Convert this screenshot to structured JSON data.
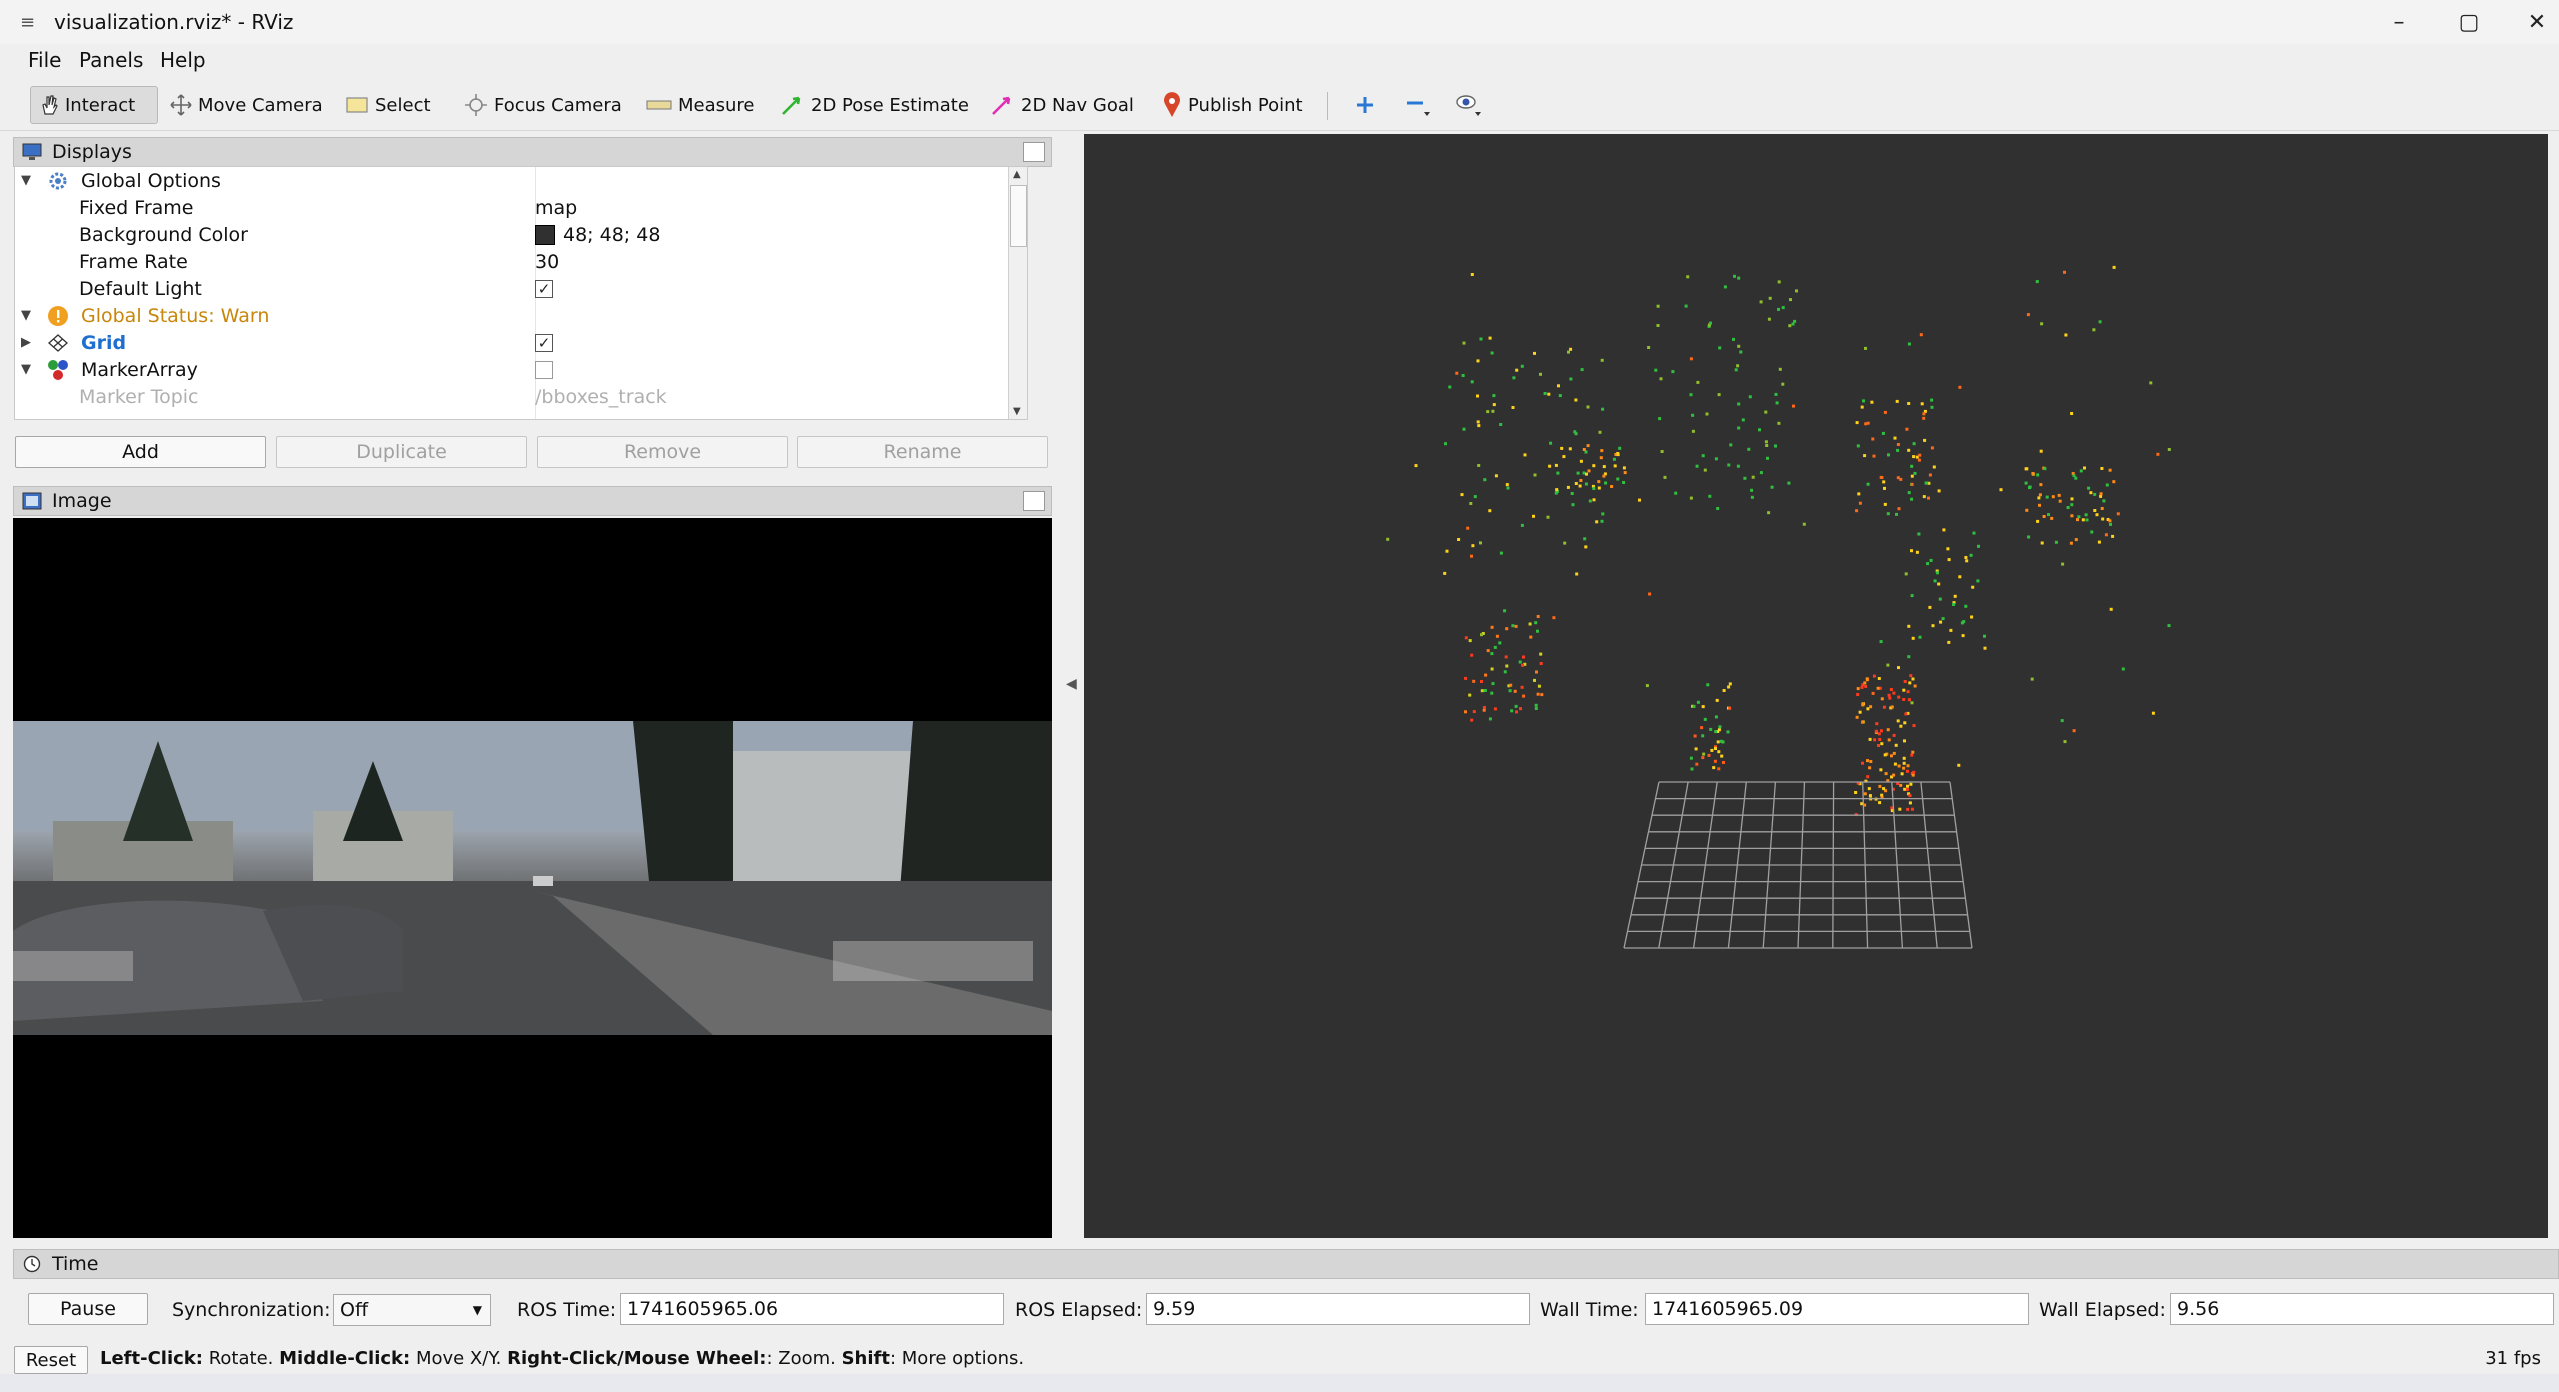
{
  "window": {
    "title": "visualization.rviz* - RViz"
  },
  "menu": [
    {
      "label": "File"
    },
    {
      "label": "Panels"
    },
    {
      "label": "Help"
    }
  ],
  "toolbar": {
    "tools": [
      {
        "label": "Interact",
        "icon": "hand-icon",
        "active": true
      },
      {
        "label": "Move Camera",
        "icon": "move-camera-icon"
      },
      {
        "label": "Select",
        "icon": "select-box-icon"
      },
      {
        "label": "Focus Camera",
        "icon": "focus-camera-icon"
      },
      {
        "label": "Measure",
        "icon": "ruler-icon"
      },
      {
        "label": "2D Pose Estimate",
        "icon": "green-arrow-icon"
      },
      {
        "label": "2D Nav Goal",
        "icon": "pink-arrow-icon"
      },
      {
        "label": "Publish Point",
        "icon": "map-pin-icon"
      }
    ]
  },
  "displays": {
    "title": "Displays",
    "rows": [
      {
        "label": "Global Options",
        "value": ""
      },
      {
        "label": "Fixed Frame",
        "value": "map"
      },
      {
        "label": "Background Color",
        "value": "48; 48; 48"
      },
      {
        "label": "Frame Rate",
        "value": "30"
      },
      {
        "label": "Default Light",
        "value": ""
      },
      {
        "label": "Global Status: Warn",
        "value": ""
      },
      {
        "label": "Grid",
        "value": ""
      },
      {
        "label": "MarkerArray",
        "value": ""
      },
      {
        "label": "Marker Topic",
        "value": "/bboxes_track"
      }
    ],
    "buttons": {
      "add": "Add",
      "duplicate": "Duplicate",
      "remove": "Remove",
      "rename": "Rename"
    }
  },
  "image_panel": {
    "title": "Image"
  },
  "time_panel": {
    "title": "Time",
    "pause": "Pause",
    "sync_label": "Synchronization:",
    "sync_value": "Off",
    "ros_time_label": "ROS Time:",
    "ros_time": "1741605965.06",
    "ros_elapsed_label": "ROS Elapsed:",
    "ros_elapsed": "9.59",
    "wall_time_label": "Wall Time:",
    "wall_time": "1741605965.09",
    "wall_elapsed_label": "Wall Elapsed:",
    "wall_elapsed": "9.56"
  },
  "status": {
    "reset": "Reset",
    "left_click_key": "Left-Click:",
    "left_click_val": "Rotate.",
    "middle_click_key": "Middle-Click:",
    "middle_click_val": "Move X/Y.",
    "right_click_key": "Right-Click/Mouse Wheel:",
    "right_click_val": ": Zoom.",
    "shift_key": "Shift",
    "shift_val": ": More options.",
    "fps": "31 fps"
  },
  "colors": {
    "background": "#303030",
    "warn": "#c8860a",
    "grid_link": "#1f6fd1"
  }
}
